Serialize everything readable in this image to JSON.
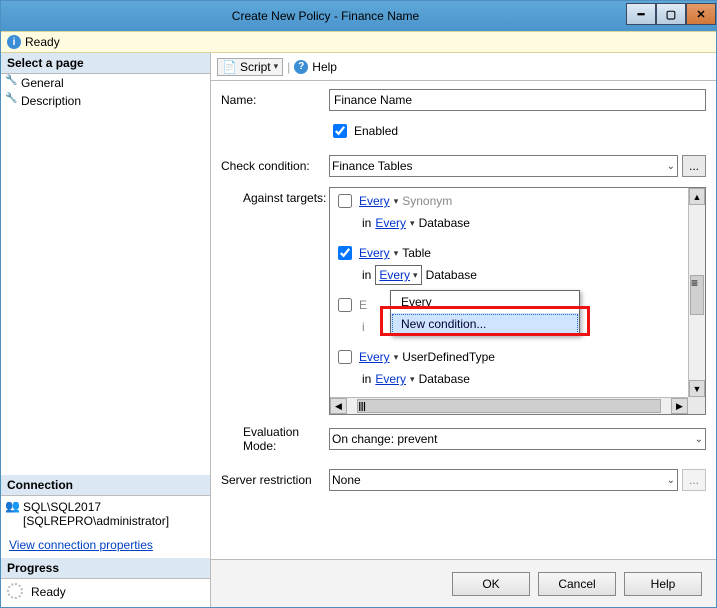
{
  "titlebar": {
    "title": "Create New Policy - Finance Name"
  },
  "readybar": {
    "text": "Ready"
  },
  "sidebar": {
    "select_page_hdr": "Select a page",
    "items": [
      "General",
      "Description"
    ],
    "connection_hdr": "Connection",
    "server": "SQL\\SQL2017",
    "user": "[SQLREPRO\\administrator]",
    "view_conn": "View connection properties",
    "progress_hdr": "Progress",
    "progress_text": "Ready"
  },
  "toolbar": {
    "script": "Script",
    "help": "Help"
  },
  "form": {
    "name_lbl": "Name:",
    "name_val": "Finance Name",
    "enabled_lbl": "Enabled",
    "check_lbl": "Check condition:",
    "check_val": "Finance Tables",
    "against_lbl": "Against targets:",
    "eval_lbl": "Evaluation Mode:",
    "eval_val": "On change: prevent",
    "restrict_lbl": "Server restriction",
    "restrict_val": "None",
    "ellipsis": "..."
  },
  "targets": {
    "every": "Every",
    "in": "in",
    "synonym": "Synonym",
    "table": "Table",
    "database": "Database",
    "udt": "UserDefinedType"
  },
  "dropdown": {
    "opt1": "Every",
    "opt2": "New condition..."
  },
  "footer": {
    "ok": "OK",
    "cancel": "Cancel",
    "help": "Help"
  }
}
